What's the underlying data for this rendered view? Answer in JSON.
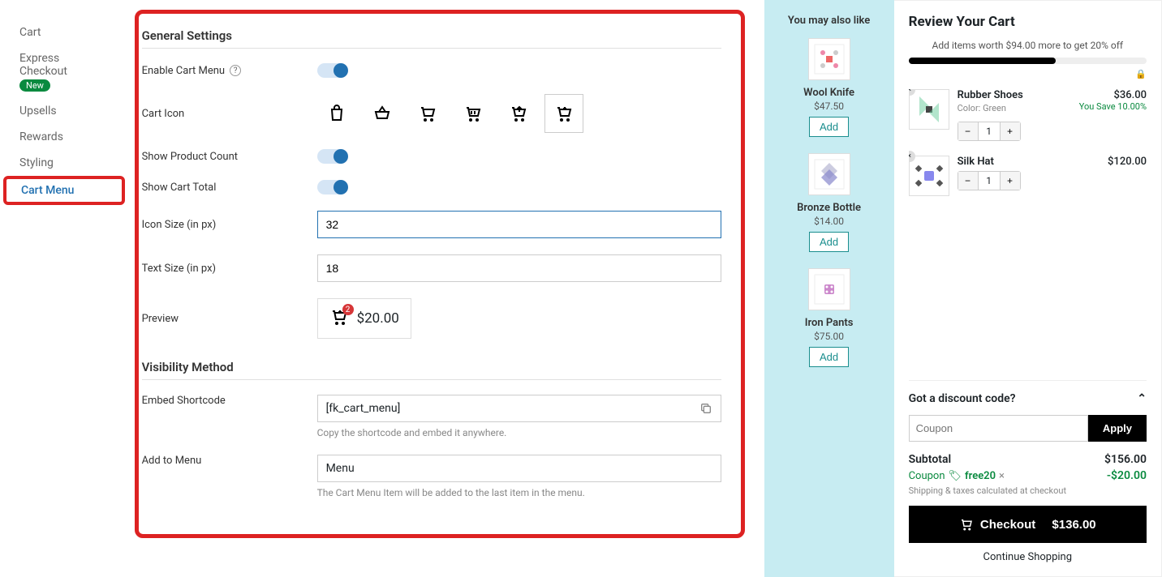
{
  "sidebar": {
    "items": [
      {
        "label": "Cart"
      },
      {
        "label": "Express Checkout",
        "badge": "New"
      },
      {
        "label": "Upsells"
      },
      {
        "label": "Rewards"
      },
      {
        "label": "Styling"
      },
      {
        "label": "Cart Menu"
      }
    ]
  },
  "settings": {
    "general_title": "General Settings",
    "enable_label": "Enable Cart Menu",
    "cart_icon_label": "Cart Icon",
    "show_count_label": "Show Product Count",
    "show_total_label": "Show Cart Total",
    "icon_size_label": "Icon Size (in px)",
    "icon_size_value": "32",
    "text_size_label": "Text Size (in px)",
    "text_size_value": "18",
    "preview_label": "Preview",
    "preview_count": "2",
    "preview_total": "$20.00",
    "visibility_title": "Visibility Method",
    "shortcode_label": "Embed Shortcode",
    "shortcode_value": "[fk_cart_menu]",
    "shortcode_help": "Copy the shortcode and embed it anywhere.",
    "menu_label": "Add to Menu",
    "menu_value": "Menu",
    "menu_help": "The Cart Menu Item will be added to the last item in the menu."
  },
  "upsells": {
    "title": "You may also like",
    "items": [
      {
        "name": "Wool Knife",
        "price": "$47.50"
      },
      {
        "name": "Bronze Bottle",
        "price": "$14.00"
      },
      {
        "name": "Iron Pants",
        "price": "$75.00"
      }
    ],
    "add_label": "Add"
  },
  "cart": {
    "title": "Review Your Cart",
    "promo": "Add items worth $94.00 more to get 20% off",
    "items": [
      {
        "name": "Rubber Shoes",
        "meta": "Color: Green",
        "price": "$36.00",
        "save": "You Save 10.00%",
        "qty": "1"
      },
      {
        "name": "Silk Hat",
        "meta": "",
        "price": "$120.00",
        "save": "",
        "qty": "1"
      }
    ],
    "discount_title": "Got a discount code?",
    "coupon_placeholder": "Coupon",
    "apply_label": "Apply",
    "subtotal_label": "Subtotal",
    "subtotal_value": "$156.00",
    "coupon_label": "Coupon",
    "coupon_code": "free20",
    "coupon_discount": "-$20.00",
    "ship_note": "Shipping & taxes calculated at checkout",
    "checkout_label": "Checkout",
    "checkout_total": "$136.00",
    "continue_label": "Continue Shopping"
  }
}
